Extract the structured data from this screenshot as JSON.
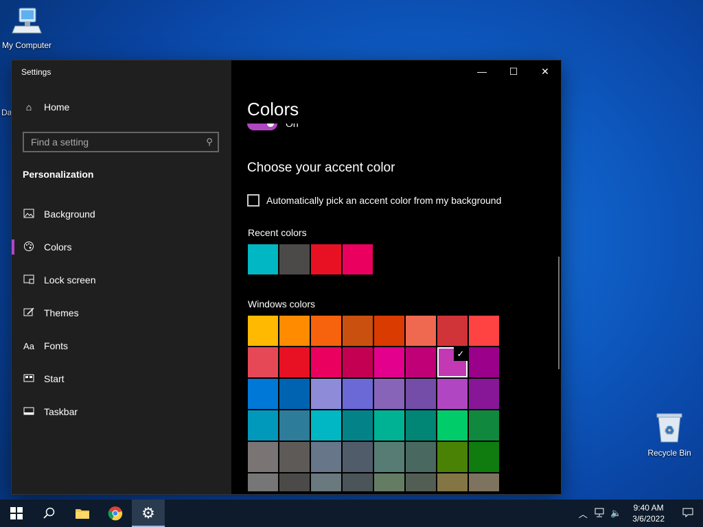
{
  "desktop": {
    "icons": [
      {
        "label": "My Computer"
      },
      {
        "label": "Recycle Bin"
      }
    ],
    "partial_left_label": "Da"
  },
  "window": {
    "title": "Settings",
    "controls": {
      "minimize": "—",
      "maximize": "☐",
      "close": "✕"
    }
  },
  "sidebar": {
    "home": "Home",
    "search_placeholder": "Find a setting",
    "section": "Personalization",
    "items": [
      {
        "label": "Background",
        "icon": "picture-icon"
      },
      {
        "label": "Colors",
        "icon": "palette-icon",
        "active": true
      },
      {
        "label": "Lock screen",
        "icon": "lock-screen-icon"
      },
      {
        "label": "Themes",
        "icon": "themes-icon"
      },
      {
        "label": "Fonts",
        "icon": "fonts-icon"
      },
      {
        "label": "Start",
        "icon": "start-icon"
      },
      {
        "label": "Taskbar",
        "icon": "taskbar-icon"
      }
    ]
  },
  "content": {
    "title": "Colors",
    "toggle_label": "On",
    "accent_heading": "Choose your accent color",
    "auto_pick_label": "Automatically pick an accent color from my background",
    "recent_label": "Recent colors",
    "recent_colors": [
      "#00b7c3",
      "#4c4a48",
      "#e81123",
      "#ea005e"
    ],
    "windows_label": "Windows colors",
    "windows_colors": [
      [
        "#ffb900",
        "#ff8c00",
        "#f7630c",
        "#ca5010",
        "#da3b01",
        "#ef6950",
        "#d13438",
        "#ff4343"
      ],
      [
        "#e74856",
        "#e81123",
        "#ea005e",
        "#c30052",
        "#e3008c",
        "#bf0077",
        "#c239b3",
        "#9a0089"
      ],
      [
        "#0078d7",
        "#0063b1",
        "#8e8cd8",
        "#6b69d6",
        "#8764b8",
        "#744da9",
        "#b146c2",
        "#881798"
      ],
      [
        "#0099bc",
        "#2d7d9a",
        "#00b7c3",
        "#038387",
        "#00b294",
        "#018574",
        "#00cc6a",
        "#10893e"
      ],
      [
        "#7a7574",
        "#5d5a58",
        "#68768a",
        "#515c6b",
        "#567c73",
        "#486860",
        "#498205",
        "#107c10"
      ],
      [
        "#767676",
        "#4c4a48",
        "#69797e",
        "#4a5459",
        "#647c64",
        "#525e54",
        "#847545",
        "#7e735f"
      ]
    ],
    "selected_color": "#c239b3"
  },
  "taskbar": {
    "time": "9:40 AM",
    "date": "3/6/2022"
  }
}
